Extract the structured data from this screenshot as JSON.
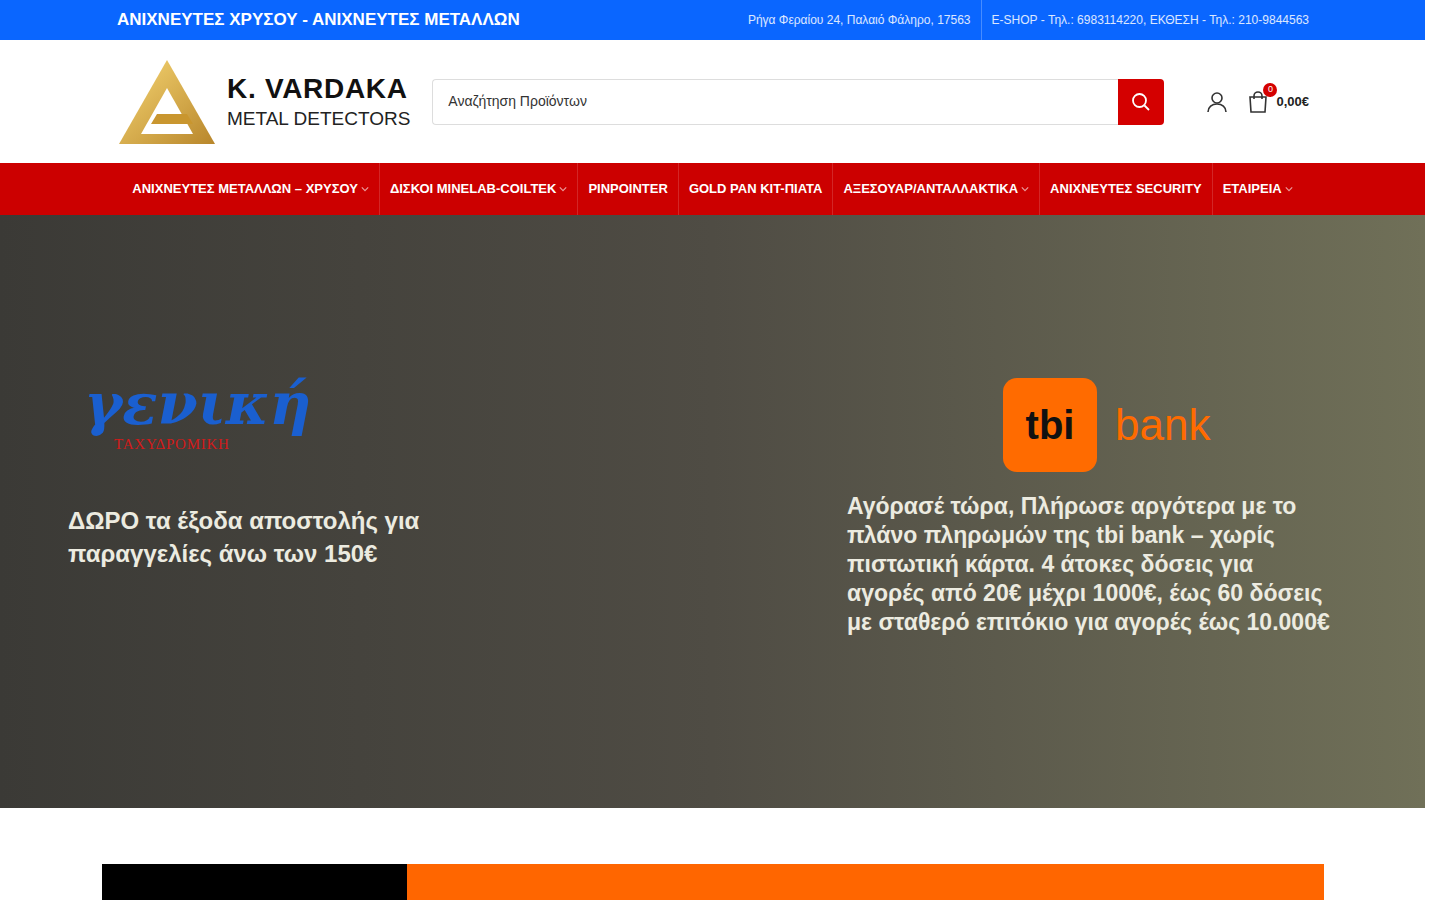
{
  "topbar": {
    "title": "ΑΝΙΧΝΕΥΤΕΣ ΧΡΥΣΟΥ - ΑΝΙΧΝΕΥΤΕΣ ΜΕΤΑΛΛΩΝ",
    "address": "Ρήγα Φεραίου 24, Παλαιό Φάληρο, 17563",
    "phones": "E-SHOP - Τηλ.: 6983114220, ΕΚΘΕΣΗ - Τηλ.: 210-9844563"
  },
  "logo": {
    "name": "K. VARDAKA",
    "tagline": "METAL DETECTORS"
  },
  "search": {
    "placeholder": "Αναζήτηση Προϊόντων"
  },
  "cart": {
    "count": "0",
    "total": "0,00€"
  },
  "nav": [
    {
      "label": "ΑΝΙΧΝΕΥΤΕΣ ΜΕΤΑΛΛΩΝ – ΧΡΥΣΟΥ",
      "dropdown": true
    },
    {
      "label": "ΔΙΣΚΟΙ MINELAB-COILTEK",
      "dropdown": true
    },
    {
      "label": "PINPOINTER",
      "dropdown": false
    },
    {
      "label": "GOLD PAN KIT-ΠΙΑΤΑ",
      "dropdown": false
    },
    {
      "label": "ΑΞΕΣΟΥΑΡ/ΑΝΤΑΛΛΑΚΤΙΚΑ",
      "dropdown": true
    },
    {
      "label": "ΑΝΙΧΝΕΥΤΕΣ SECURITY",
      "dropdown": false
    },
    {
      "label": "ΕΤΑΙΡΕΙΑ",
      "dropdown": true
    }
  ],
  "hero": {
    "left": {
      "logo_main": "γενική",
      "logo_sub": "ΤΑΧΥΔΡΟΜΙΚΗ",
      "text": "ΔΩΡΟ τα έξοδα αποστολής για παραγγελίες άνω των 150€"
    },
    "right": {
      "logo_box": "tbi",
      "logo_word": "bank",
      "text": "Αγόρασέ τώρα, Πλήρωσε αργότερα με το πλάνο πληρωμών της tbi bank – χωρίς πιστωτική κάρτα. 4 άτοκες δόσεις για αγορές από 20€ μέχρι 1000€, έως 60 δόσεις με σταθερό επιτόκιο για αγορές έως 10.000€"
    }
  }
}
